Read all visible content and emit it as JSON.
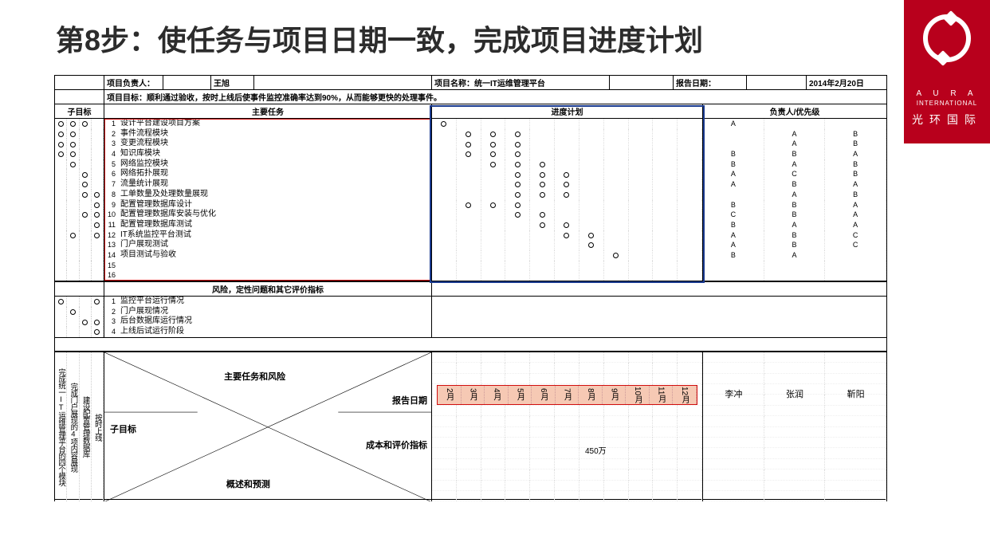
{
  "title": "第8步：使任务与项目日期一致，完成项目进度计划",
  "logo": {
    "brand_en": "A U R A",
    "brand_sub": "INTERNATIONAL",
    "brand_cn": "光环国际"
  },
  "header": {
    "owner_label": "项目负责人：",
    "owner": "王旭",
    "proj_name_label": "项目名称：",
    "proj_name": "统一IT运维管理平台",
    "report_date_label": "报告日期：",
    "report_date": "2014年2月20日",
    "goal_label": "项目目标：",
    "goal_text": "顺利通过验收，按时上线后使事件监控准确率达到90%，从而能够更快的处理事件。"
  },
  "section_labels": {
    "sub_target": "子目标",
    "main_tasks": "主要任务",
    "schedule": "进度计划",
    "owner_priority": "负责人/优先级",
    "risks": "风险，定性问题和其它评价指标"
  },
  "sub_target_marks": [
    [
      1,
      1,
      1,
      0
    ],
    [
      1,
      1,
      0,
      0
    ],
    [
      1,
      1,
      0,
      0
    ],
    [
      1,
      1,
      0,
      0
    ],
    [
      0,
      1,
      0,
      0
    ],
    [
      0,
      0,
      1,
      0
    ],
    [
      0,
      0,
      1,
      0
    ],
    [
      0,
      0,
      1,
      1
    ],
    [
      0,
      0,
      0,
      1
    ],
    [
      0,
      0,
      1,
      1
    ],
    [
      0,
      0,
      0,
      1
    ],
    [
      0,
      1,
      0,
      1
    ],
    [
      0,
      0,
      0,
      0
    ],
    [
      0,
      0,
      0,
      0
    ],
    [
      0,
      0,
      0,
      0
    ],
    [
      0,
      0,
      0,
      0
    ]
  ],
  "tasks": [
    "设计平台建设项目方案",
    "事件流程模块",
    "变更流程模块",
    "知识库模块",
    "网络监控模块",
    "网络拓扑展现",
    "流量统计展现",
    "工单数量及处理数量展现",
    "配置管理数据库设计",
    "配置管理数据库安装与优化",
    "配置管理数据库测试",
    "IT系统监控平台测试",
    "门户展现测试",
    "项目测试与验收",
    "",
    ""
  ],
  "schedule": [
    [
      1,
      0,
      0,
      0,
      0,
      0,
      0,
      0,
      0,
      0,
      0
    ],
    [
      0,
      1,
      1,
      1,
      0,
      0,
      0,
      0,
      0,
      0,
      0
    ],
    [
      0,
      1,
      1,
      1,
      0,
      0,
      0,
      0,
      0,
      0,
      0
    ],
    [
      0,
      1,
      1,
      1,
      0,
      0,
      0,
      0,
      0,
      0,
      0
    ],
    [
      0,
      0,
      1,
      1,
      1,
      0,
      0,
      0,
      0,
      0,
      0
    ],
    [
      0,
      0,
      0,
      1,
      1,
      1,
      0,
      0,
      0,
      0,
      0
    ],
    [
      0,
      0,
      0,
      1,
      1,
      1,
      0,
      0,
      0,
      0,
      0
    ],
    [
      0,
      0,
      0,
      1,
      1,
      1,
      0,
      0,
      0,
      0,
      0
    ],
    [
      0,
      1,
      1,
      1,
      0,
      0,
      0,
      0,
      0,
      0,
      0
    ],
    [
      0,
      0,
      0,
      1,
      1,
      0,
      0,
      0,
      0,
      0,
      0
    ],
    [
      0,
      0,
      0,
      0,
      1,
      1,
      0,
      0,
      0,
      0,
      0
    ],
    [
      0,
      0,
      0,
      0,
      0,
      1,
      1,
      0,
      0,
      0,
      0
    ],
    [
      0,
      0,
      0,
      0,
      0,
      0,
      1,
      0,
      0,
      0,
      0
    ],
    [
      0,
      0,
      0,
      0,
      0,
      0,
      0,
      1,
      0,
      0,
      0
    ],
    [
      0,
      0,
      0,
      0,
      0,
      0,
      0,
      0,
      0,
      0,
      0
    ],
    [
      0,
      0,
      0,
      0,
      0,
      0,
      0,
      0,
      0,
      0,
      0
    ]
  ],
  "responsibility": [
    [
      "A",
      "",
      ""
    ],
    [
      "",
      "A",
      "B"
    ],
    [
      "",
      "A",
      "B"
    ],
    [
      "B",
      "B",
      "A"
    ],
    [
      "B",
      "A",
      "B"
    ],
    [
      "A",
      "C",
      "B"
    ],
    [
      "A",
      "B",
      "A"
    ],
    [
      "",
      "A",
      "B"
    ],
    [
      "B",
      "B",
      "A"
    ],
    [
      "C",
      "B",
      "A"
    ],
    [
      "B",
      "A",
      "A"
    ],
    [
      "A",
      "B",
      "C"
    ],
    [
      "A",
      "B",
      "C"
    ],
    [
      "B",
      "A",
      ""
    ],
    [
      "",
      "",
      ""
    ],
    [
      "",
      "",
      ""
    ]
  ],
  "risk_marks": [
    [
      1,
      0,
      0,
      1
    ],
    [
      0,
      1,
      0,
      0
    ],
    [
      0,
      0,
      1,
      1
    ],
    [
      0,
      0,
      0,
      1
    ]
  ],
  "risks": [
    "监控平台运行情况",
    "门户展现情况",
    "后台数据库运行情况",
    "上线后试运行阶段"
  ],
  "bottom": {
    "vertical_labels": [
      "完成统一IT运维管理平台的四个模块",
      "完成门户展现的4项内容展现",
      "建设配置管理数据库",
      "按时上线"
    ],
    "x_labels": {
      "top": "主要任务和风险",
      "rdate": "报告日期",
      "sub": "子目标",
      "cost": "成本和评价指标",
      "summary": "概述和预测"
    },
    "months": [
      "2月",
      "3月",
      "4月",
      "5月",
      "6月",
      "7月",
      "8月",
      "9月",
      "10月",
      "11月",
      "12月"
    ],
    "cost": "450万",
    "people": [
      "李冲",
      "张润",
      "靳阳"
    ]
  }
}
